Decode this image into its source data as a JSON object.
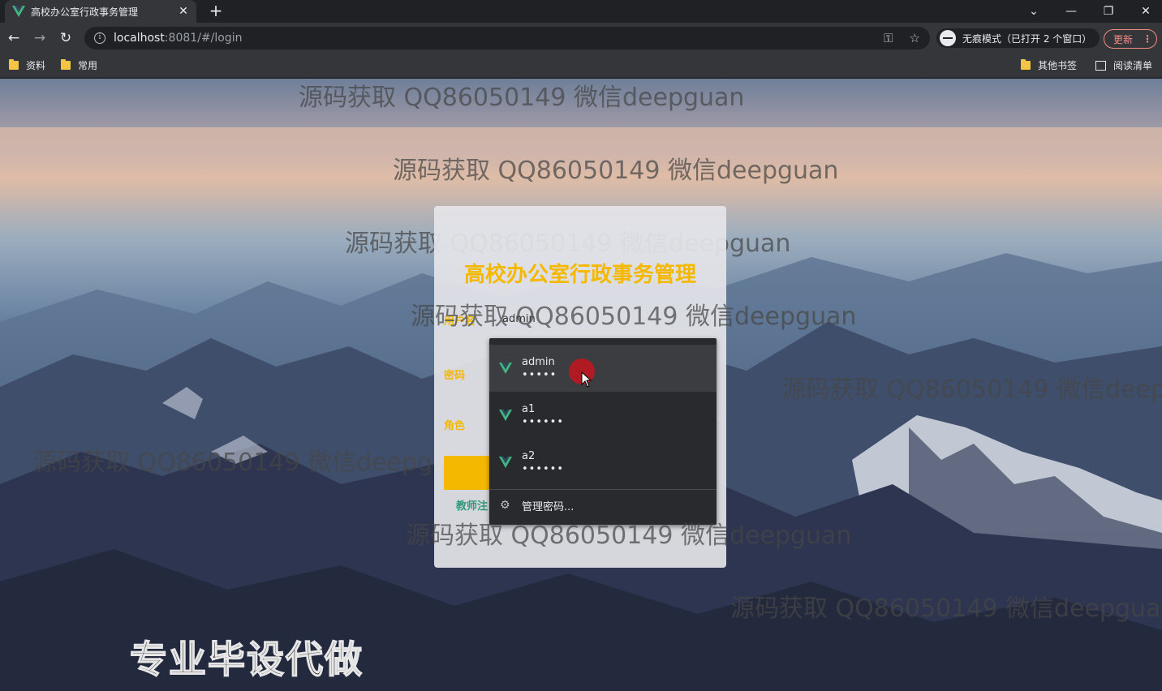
{
  "browser": {
    "tab_title": "高校办公室行政事务管理",
    "url_host": "localhost",
    "url_rest": ":8081/#/login",
    "incognito_label": "无痕模式（已打开 2 个窗口）",
    "update_label": "更新",
    "bookmarks": [
      {
        "label": "资料"
      },
      {
        "label": "常用"
      }
    ],
    "other_bookmarks": "其他书签",
    "reading_list": "阅读清单"
  },
  "login": {
    "title": "高校办公室行政事务管理",
    "username_label": "用户名",
    "username_value": "admin",
    "password_label": "密码",
    "role_label": "角色",
    "register_link": "教师注"
  },
  "autofill": {
    "items": [
      {
        "user": "admin",
        "pass": "•••••"
      },
      {
        "user": "a1",
        "pass": "••••••"
      },
      {
        "user": "a2",
        "pass": "••••••"
      }
    ],
    "manage_label": "管理密码..."
  },
  "overlay": {
    "watermark": "源码获取 QQ86050149 微信deepguan",
    "promo": "专业毕设代做"
  },
  "colors": {
    "accent": "#f5b800",
    "link": "#2f9a7a",
    "vue_green": "#41b883"
  }
}
